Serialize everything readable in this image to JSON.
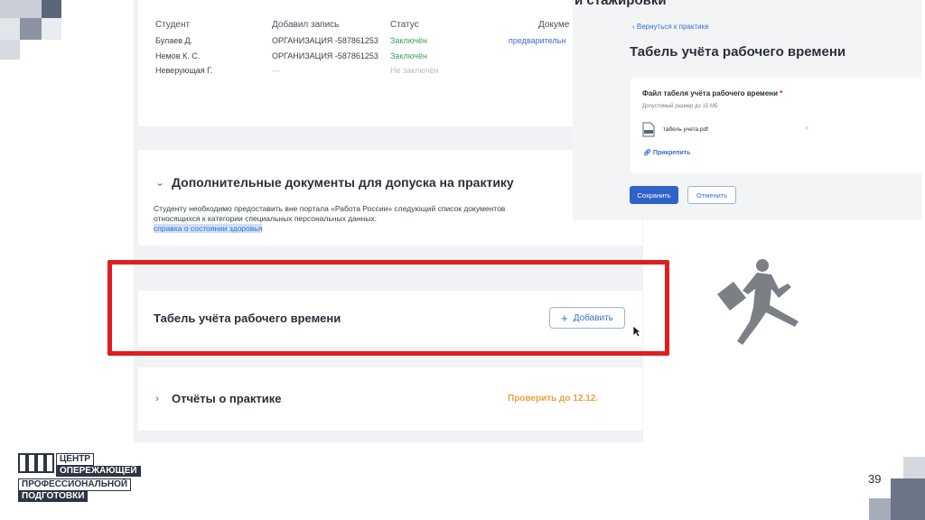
{
  "table": {
    "headers": [
      "Студент",
      "Добавил запись",
      "Статус",
      "Докуме"
    ],
    "rows": [
      {
        "student": "Булаев Д.",
        "added_by": "ОРГАНИЗАЦИЯ -587861253",
        "status": "Заключён",
        "doc": "предварительн"
      },
      {
        "student": "Немов К. С.",
        "added_by": "ОРГАНИЗАЦИЯ -587861253",
        "status": "Заключён",
        "doc": ""
      },
      {
        "student": "Неверующая Г.",
        "added_by": "—",
        "status": "Не заключён",
        "doc": ""
      }
    ]
  },
  "extra_docs": {
    "title": "Дополнительные документы для допуска на практику",
    "text_line1": "Студенту необходимо предоставить вне портала «Работа России» следующий список документов",
    "text_line2": "относящихся к категории специальных персональных данных:",
    "link": "справка о состоянии здоровья"
  },
  "timesheet": {
    "title": "Табель учёта рабочего времени",
    "add_label": "Добавить"
  },
  "reports": {
    "title": "Отчёты о практике",
    "status": "Проверить до 12.12."
  },
  "panel": {
    "top_text": "и стажировки",
    "back_label": "Вернуться к практике",
    "title": "Табель учёта рабочего времени",
    "file_label": "Файл табеля учёта рабочего времени",
    "required_mark": "*",
    "size_hint": "Допустимый размер до 15 МБ",
    "file_name": "табель учета.pdf",
    "attach_label": "Прикрепить",
    "save_label": "Сохранить",
    "cancel_label": "Отменить"
  },
  "logo": {
    "line1": "ЦЕНТР",
    "line2": "ОПЕРЕЖАЮЩЕЙ",
    "line3": "ПРОФЕССИОНАЛЬНОЙ",
    "line4": "ПОДГОТОВКИ"
  },
  "slide": {
    "page_number": "39"
  },
  "icons": {
    "chevron": "chevron-icon",
    "plus": "plus-icon",
    "cursor": "mouse-cursor-icon",
    "pdf": "pdf-file-icon",
    "paperclip": "paperclip-icon",
    "close": "close-icon",
    "back": "back-chevron-icon",
    "figure": "running-businessman-icon"
  },
  "colors": {
    "accent": "#2f63c8",
    "highlight_frame": "#e01e1e",
    "status_ok": "#3aa35c",
    "warning": "#e8a33c"
  }
}
